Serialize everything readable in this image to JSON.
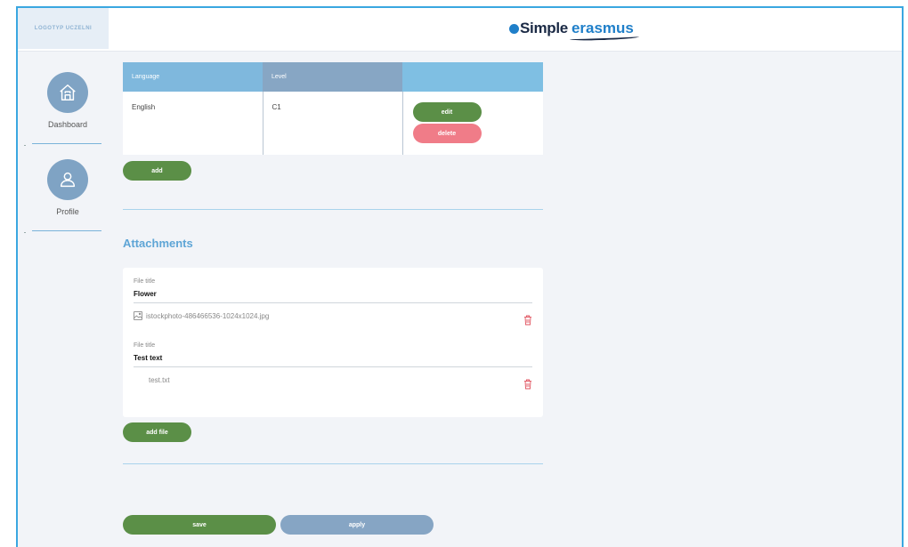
{
  "header": {
    "logo_text": "LOGOTYP UCZELNI",
    "brand_part1": "Simple",
    "brand_part2": "erasmus"
  },
  "sidebar": {
    "items": [
      {
        "label": "Dashboard",
        "icon": "home-icon"
      },
      {
        "label": "Profile",
        "icon": "user-icon"
      }
    ]
  },
  "languages": {
    "columns": [
      "Language",
      "Level",
      ""
    ],
    "rows": [
      {
        "language": "English",
        "level": "C1"
      }
    ],
    "edit_label": "edit",
    "delete_label": "delete",
    "add_label": "add"
  },
  "attachments": {
    "title": "Attachments",
    "file_title_label": "File title",
    "files": [
      {
        "title": "Flower",
        "filename": "istockphoto-486466536-1024x1024.jpg",
        "icon": "image-file-icon"
      },
      {
        "title": "Test text",
        "filename": "test.txt",
        "icon": "text-file-icon"
      }
    ],
    "add_file_label": "add file"
  },
  "actions": {
    "save_label": "save",
    "apply_label": "apply"
  },
  "colors": {
    "frame": "#3aa7e0",
    "accent_blue": "#5ea5d6",
    "green": "#5b8f47",
    "pink": "#f07c88",
    "slate_blue": "#86a5c4"
  }
}
